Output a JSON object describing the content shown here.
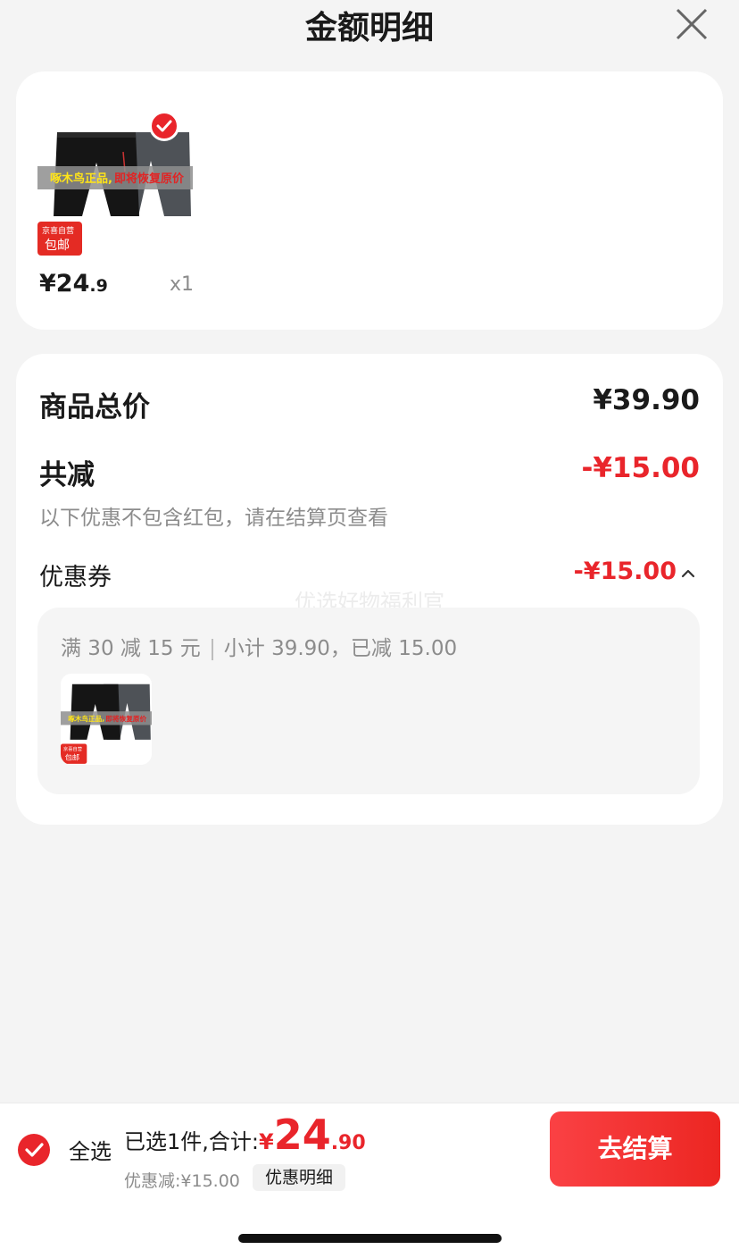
{
  "header": {
    "title": "金额明细",
    "close_icon": "close-icon"
  },
  "goods": {
    "price_int": "¥24",
    "price_dec": ".9",
    "quantity": "x1",
    "selected": true,
    "image_text": {
      "banner": "啄木鸟正品，即将恢复原价",
      "badge_top": "京喜自营",
      "badge_bottom": "包邮"
    }
  },
  "summary": {
    "total_label": "商品总价",
    "total_value": "¥39.90",
    "reduce_label": "共减",
    "reduce_value": "-¥15.00",
    "note": "以下优惠不包含红包，请在结算页查看",
    "coupon_label": "优惠券",
    "coupon_value": "-¥15.00",
    "watermark": "优选好物福利官"
  },
  "coupon_detail": {
    "condition": "满 30 减 15 元",
    "subtotal": "小计 39.90，已减 15.00"
  },
  "bottom": {
    "select_all": "全选",
    "selected_text": "已选1件,合计:",
    "total_yen": "¥",
    "total_int": "24",
    "total_dec": ".90",
    "discount_text": "优惠减:¥15.00",
    "detail_button": "优惠明细",
    "checkout_button": "去结算"
  },
  "colors": {
    "accent": "#e9252b",
    "muted": "#8c8c8c",
    "background": "#f4f4f4"
  }
}
